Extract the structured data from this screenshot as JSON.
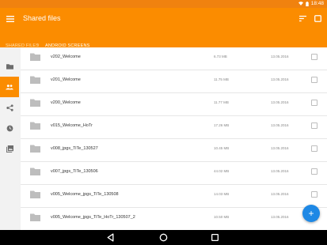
{
  "status_bar": {
    "time": "18:48",
    "wifi_icon": "wifi-icon",
    "battery_icon": "battery-icon"
  },
  "app_bar": {
    "title": "Shared files",
    "menu_icon": "hamburger-menu-icon",
    "sort_icon": "sort-icon",
    "select_icon": "checkbox-icon"
  },
  "breadcrumb": {
    "root": "SHARED FILES",
    "separator": "›",
    "current": "ANDROID SCREENS"
  },
  "sidebar": {
    "items": [
      {
        "icon": "folder-icon",
        "active": false
      },
      {
        "icon": "people-icon",
        "active": true
      },
      {
        "icon": "share-icon",
        "active": false
      },
      {
        "icon": "history-icon",
        "active": false
      },
      {
        "icon": "gallery-icon",
        "active": false
      }
    ]
  },
  "files": [
    {
      "name": "v202_Welcome",
      "size": "6.73 MB",
      "date": "13.05.2016"
    },
    {
      "name": "v201_Welcome",
      "size": "11.75 MB",
      "date": "13.05.2016"
    },
    {
      "name": "v200_Welcome",
      "size": "11.77 MB",
      "date": "13.05.2016"
    },
    {
      "name": "v015_Welcome_HoTr",
      "size": "17.26 MB",
      "date": "13.05.2016"
    },
    {
      "name": "v008_jpgs_TiTe_130527",
      "size": "10.45 MB",
      "date": "13.05.2016"
    },
    {
      "name": "v007_jpgs_TiTe_130506",
      "size": "44.02 MB",
      "date": "13.05.2016"
    },
    {
      "name": "v005_Welcome_jpgs_TiTe_130508",
      "size": "14.03 MB",
      "date": "13.05.2016"
    },
    {
      "name": "v005_Welcome_jpgs_TiTe_HoTr_130507_2",
      "size": "10.50 MB",
      "date": "13.05.2016"
    }
  ],
  "fab": {
    "label": "+"
  },
  "nav_bar": {
    "back_icon": "back-icon",
    "home_icon": "home-icon",
    "recents_icon": "recents-icon"
  },
  "colors": {
    "primary": "#fb8c00",
    "status_bar": "#f0820f",
    "fab": "#1e88e5"
  }
}
